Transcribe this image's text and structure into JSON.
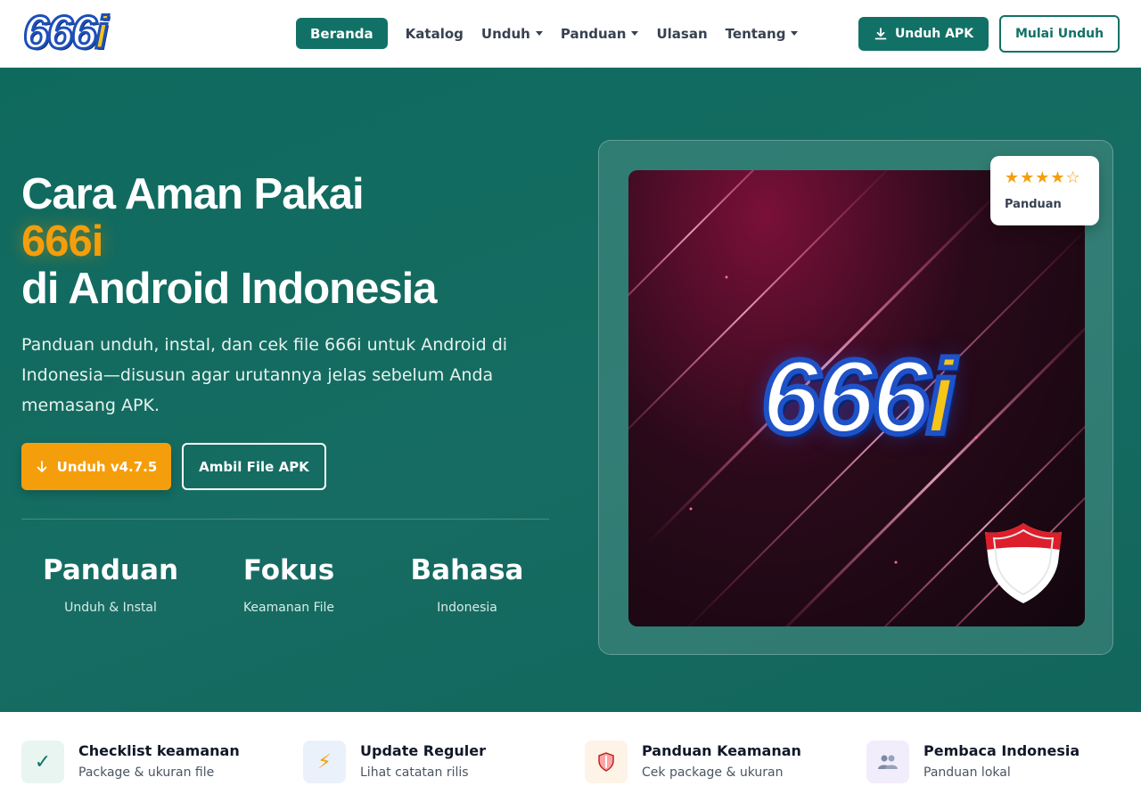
{
  "brand": {
    "logo_main": "666",
    "logo_i": "i"
  },
  "nav": {
    "items": [
      {
        "label": "Beranda",
        "dropdown": false,
        "active": true
      },
      {
        "label": "Katalog",
        "dropdown": false,
        "active": false
      },
      {
        "label": "Unduh",
        "dropdown": true,
        "active": false
      },
      {
        "label": "Panduan",
        "dropdown": true,
        "active": false
      },
      {
        "label": "Ulasan",
        "dropdown": false,
        "active": false
      },
      {
        "label": "Tentang",
        "dropdown": true,
        "active": false
      }
    ],
    "download_apk": "Unduh APK",
    "start_download": "Mulai Unduh"
  },
  "hero": {
    "title_line1": "Cara Aman Pakai",
    "title_accent": "666i",
    "title_line3": "di Android Indonesia",
    "description": "Panduan unduh, instal, dan cek file 666i untuk Android di Indonesia—disusun agar urutannya jelas sebelum Anda memasang APK.",
    "btn_primary": "Unduh v4.7.5",
    "btn_secondary": "Ambil File APK",
    "stats": [
      {
        "value": "Panduan",
        "label": "Unduh & Instal"
      },
      {
        "value": "Fokus",
        "label": "Keamanan File"
      },
      {
        "value": "Bahasa",
        "label": "Indonesia"
      }
    ],
    "rating": {
      "stars": 4,
      "max": 5,
      "label": "Panduan"
    }
  },
  "features": [
    {
      "title": "Checklist keamanan",
      "subtitle": "Package & ukuran file",
      "icon": "check-icon",
      "bg": "#e8f5f1",
      "fg": "#127166"
    },
    {
      "title": "Update Reguler",
      "subtitle": "Lihat catatan rilis",
      "icon": "lightning-icon",
      "bg": "#eaf1fb",
      "fg": "#f59e0b"
    },
    {
      "title": "Panduan Keamanan",
      "subtitle": "Cek package & ukuran",
      "icon": "shield-icon",
      "bg": "#fdf3e6",
      "fg": "#dc2626"
    },
    {
      "title": "Pembaca Indonesia",
      "subtitle": "Panduan lokal",
      "icon": "users-icon",
      "bg": "#f1edfb",
      "fg": "#6b7280"
    }
  ],
  "colors": {
    "primary": "#127166",
    "accent": "#f59e0b",
    "hero_bg": "#166c62"
  }
}
